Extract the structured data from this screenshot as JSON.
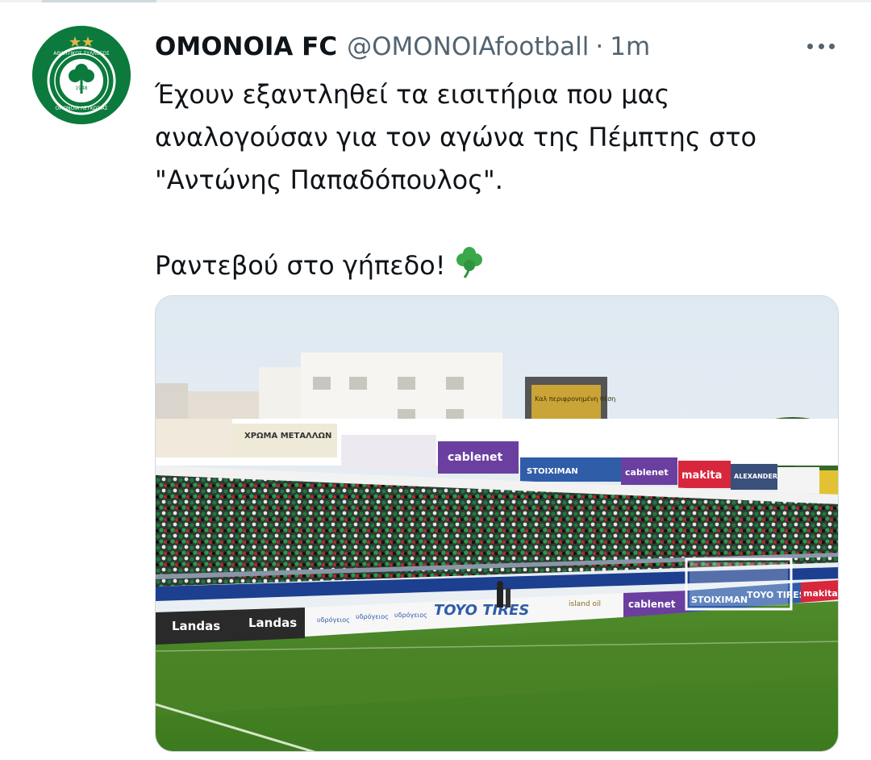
{
  "tweet": {
    "author_name": "OMONOIA FC",
    "handle": "@OMONOIAfootball",
    "separator": "·",
    "time": "1m",
    "more_icon": "more-horizontal-icon",
    "text_lines": [
      "Έχουν εξαντληθεί τα εισιτήρια που μας",
      "αναλογούσαν για τον αγώνα της Πέμπτης στο",
      "\"Αντώνης Παπαδόπουλος\"."
    ],
    "text_line_2": "Ραντεβού στο γήπεδο!",
    "emoji": "shamrock-icon"
  },
  "avatar": {
    "logo_text_top": "ΑΘΛΗΤΙΚΟΣ ΣΥΛΛΟΓΟΣ",
    "logo_text_bottom": "ΟΜΟΝΟΙΑ ΛΕΥΚΩΣΙΑΣ",
    "logo_year": "1948"
  },
  "photo": {
    "ads_upper": [
      "ΧΡΩΜΑ ΜΕΤΑΛΛΩΝ",
      "cablenet",
      "STOIXIMAN",
      "cablenet",
      "makita",
      "ALEXANDER"
    ],
    "ads_lower": [
      "Landas",
      "Landas",
      "υδρόγειος",
      "υδρόγειος",
      "υδρόγειος",
      "TOYO TIRES",
      "island oil",
      "cablenet",
      "STOIXIMAN",
      "TOYO TIRES",
      "makita"
    ],
    "scoreboard_text": "Καλ περιφρονημένη θέση"
  },
  "colors": {
    "club_green": "#0b7a3c",
    "secondary_text": "#536471"
  }
}
